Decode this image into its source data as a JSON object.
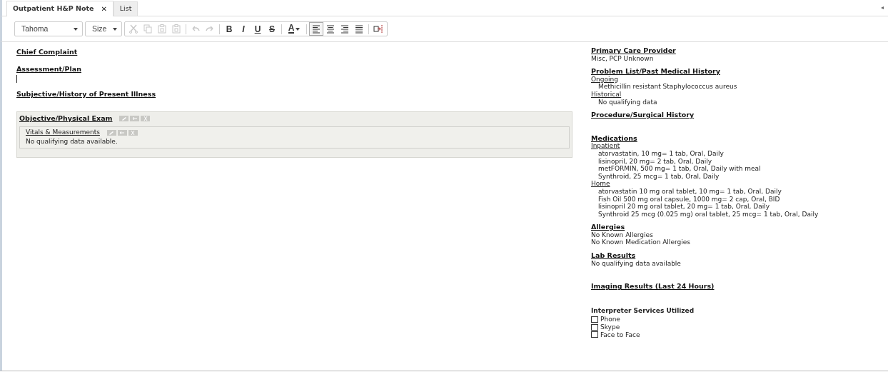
{
  "tabs": [
    {
      "label": "Outpatient H&P Note",
      "selected": true,
      "close": "✕"
    },
    {
      "label": "List",
      "selected": false
    }
  ],
  "collapse_glyph": "◂",
  "toolbar": {
    "font": "Tahoma",
    "size": "Size",
    "groups": [
      [
        {
          "kind": "cut",
          "disabled": true
        },
        {
          "kind": "copy",
          "disabled": true
        },
        {
          "kind": "paste",
          "disabled": true
        },
        {
          "kind": "paste",
          "disabled": true
        }
      ],
      [
        {
          "kind": "undo",
          "disabled": true
        },
        {
          "kind": "redo",
          "disabled": true
        }
      ],
      [
        {
          "kind": "bold",
          "label": "B",
          "disabled": false
        },
        {
          "kind": "italic",
          "label": "I",
          "disabled": false
        },
        {
          "kind": "underline",
          "label": "U",
          "disabled": false
        },
        {
          "kind": "strike",
          "label": "S",
          "disabled": false
        }
      ],
      [
        {
          "kind": "color",
          "label": "A",
          "disabled": false
        }
      ],
      [
        {
          "kind": "align-left",
          "selected": true,
          "disabled": false
        },
        {
          "kind": "align-center",
          "selected": false,
          "disabled": false
        },
        {
          "kind": "align-right",
          "selected": false,
          "disabled": false
        },
        {
          "kind": "justify",
          "selected": false,
          "disabled": false
        }
      ],
      [
        {
          "kind": "insert",
          "disabled": false
        }
      ]
    ]
  },
  "left_sections": [
    {
      "kind": "heading",
      "title": "Chief Complaint"
    },
    {
      "kind": "heading",
      "title": "Assessment/Plan",
      "cursor": true
    },
    {
      "kind": "heading",
      "title": "Subjective/History of Present Illness"
    },
    {
      "kind": "panel",
      "title": "Objective/Physical Exam",
      "subpanels": [
        {
          "title": "Vitals & Measurements",
          "text": "No qualifying data available."
        }
      ]
    }
  ],
  "right_sections": [
    {
      "title": "Primary Care Provider",
      "lines": [
        "Misc, PCP Unknown"
      ]
    },
    {
      "title": "Problem List/Past Medical History",
      "groups": [
        {
          "label": "Ongoing",
          "items": [
            "Methicillin resistant Staphylococcus aureus"
          ]
        },
        {
          "label": "Historical",
          "items": [
            "No qualifying data"
          ]
        }
      ]
    },
    {
      "title": "Procedure/Surgical History"
    },
    {
      "title": "Medications",
      "groups": [
        {
          "label": "Inpatient",
          "items": [
            "atorvastatin, 10 mg= 1 tab, Oral, Daily",
            "lisinopril, 20 mg= 2 tab, Oral, Daily",
            "metFORMIN, 500 mg= 1 tab, Oral, Daily with meal",
            "Synthroid, 25 mcg= 1 tab, Oral, Daily"
          ]
        },
        {
          "label": "Home",
          "items": [
            "atorvastatin 10 mg oral tablet, 10 mg= 1 tab, Oral, Daily",
            "Fish Oil 500 mg oral capsule, 1000 mg= 2 cap, Oral, BID",
            "lisinopril 20 mg oral tablet, 20 mg= 1 tab, Oral, Daily",
            "Synthroid 25 mcg (0.025 mg) oral tablet, 25 mcg= 1 tab, Oral, Daily"
          ]
        }
      ]
    },
    {
      "title": "Allergies",
      "lines": [
        "No Known Allergies",
        "No Known Medication Allergies"
      ]
    },
    {
      "title": "Lab Results",
      "lines": [
        "No qualifying data available"
      ]
    },
    {
      "title": "Imaging Results (Last 24 Hours)"
    }
  ],
  "interpreter": {
    "title": "Interpreter Services Utilized",
    "options": [
      {
        "label": "Phone",
        "checked": false
      },
      {
        "label": "Skype",
        "checked": false
      },
      {
        "label": "Face to Face",
        "checked": false
      }
    ]
  }
}
